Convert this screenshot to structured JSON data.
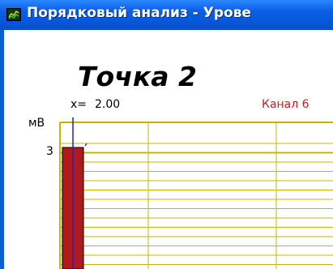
{
  "window": {
    "title": "Порядковый анализ - Урове"
  },
  "header": {
    "point_title": "Точка 2",
    "x_label": "x=",
    "x_value": "2.00",
    "channel": "Канал 6"
  },
  "chart_data": {
    "type": "bar",
    "ylabel": "мВ",
    "y_ticks": [
      "3"
    ],
    "x": [
      2.0
    ],
    "values": [
      3.0
    ],
    "grid": true,
    "colors": {
      "grid": "#c8b400",
      "bar": "#b01a1a",
      "bar_edge": "#000000",
      "cursor": "#2020d0"
    }
  }
}
